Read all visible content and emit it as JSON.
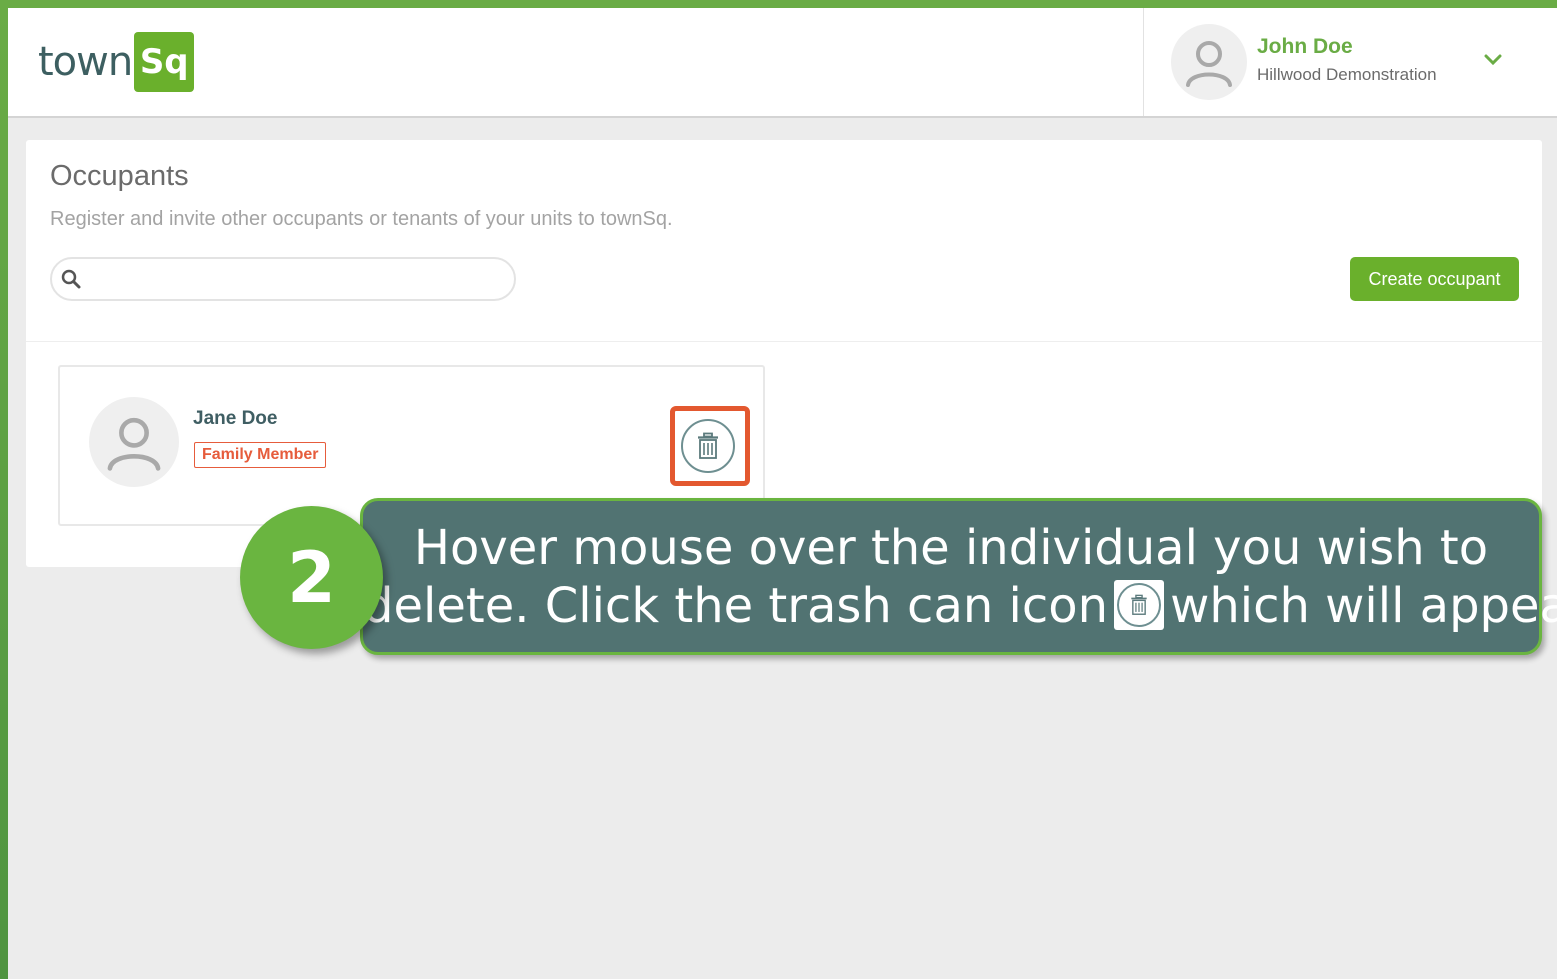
{
  "brand": {
    "logo_text": "town",
    "logo_box_text": "Sq",
    "accent_color": "#6ab02c",
    "highlight_color": "#e3582f"
  },
  "user": {
    "name": "John Doe",
    "organization": "Hillwood Demonstration",
    "menu_icon": "chevron-down-icon"
  },
  "page": {
    "title": "Occupants",
    "subtitle": "Register and invite other occupants or tenants of your units to townSq.",
    "search": {
      "placeholder": "",
      "value": ""
    },
    "create_button_label": "Create occupant"
  },
  "occupants": [
    {
      "name": "Jane Doe",
      "role": "Family Member",
      "action_icon": "trash-icon"
    }
  ],
  "callout": {
    "step_number": "2",
    "line1": "Hover mouse over the individual you wish to",
    "line2_before": "delete. Click the trash can icon",
    "line2_after": "which will appear."
  }
}
